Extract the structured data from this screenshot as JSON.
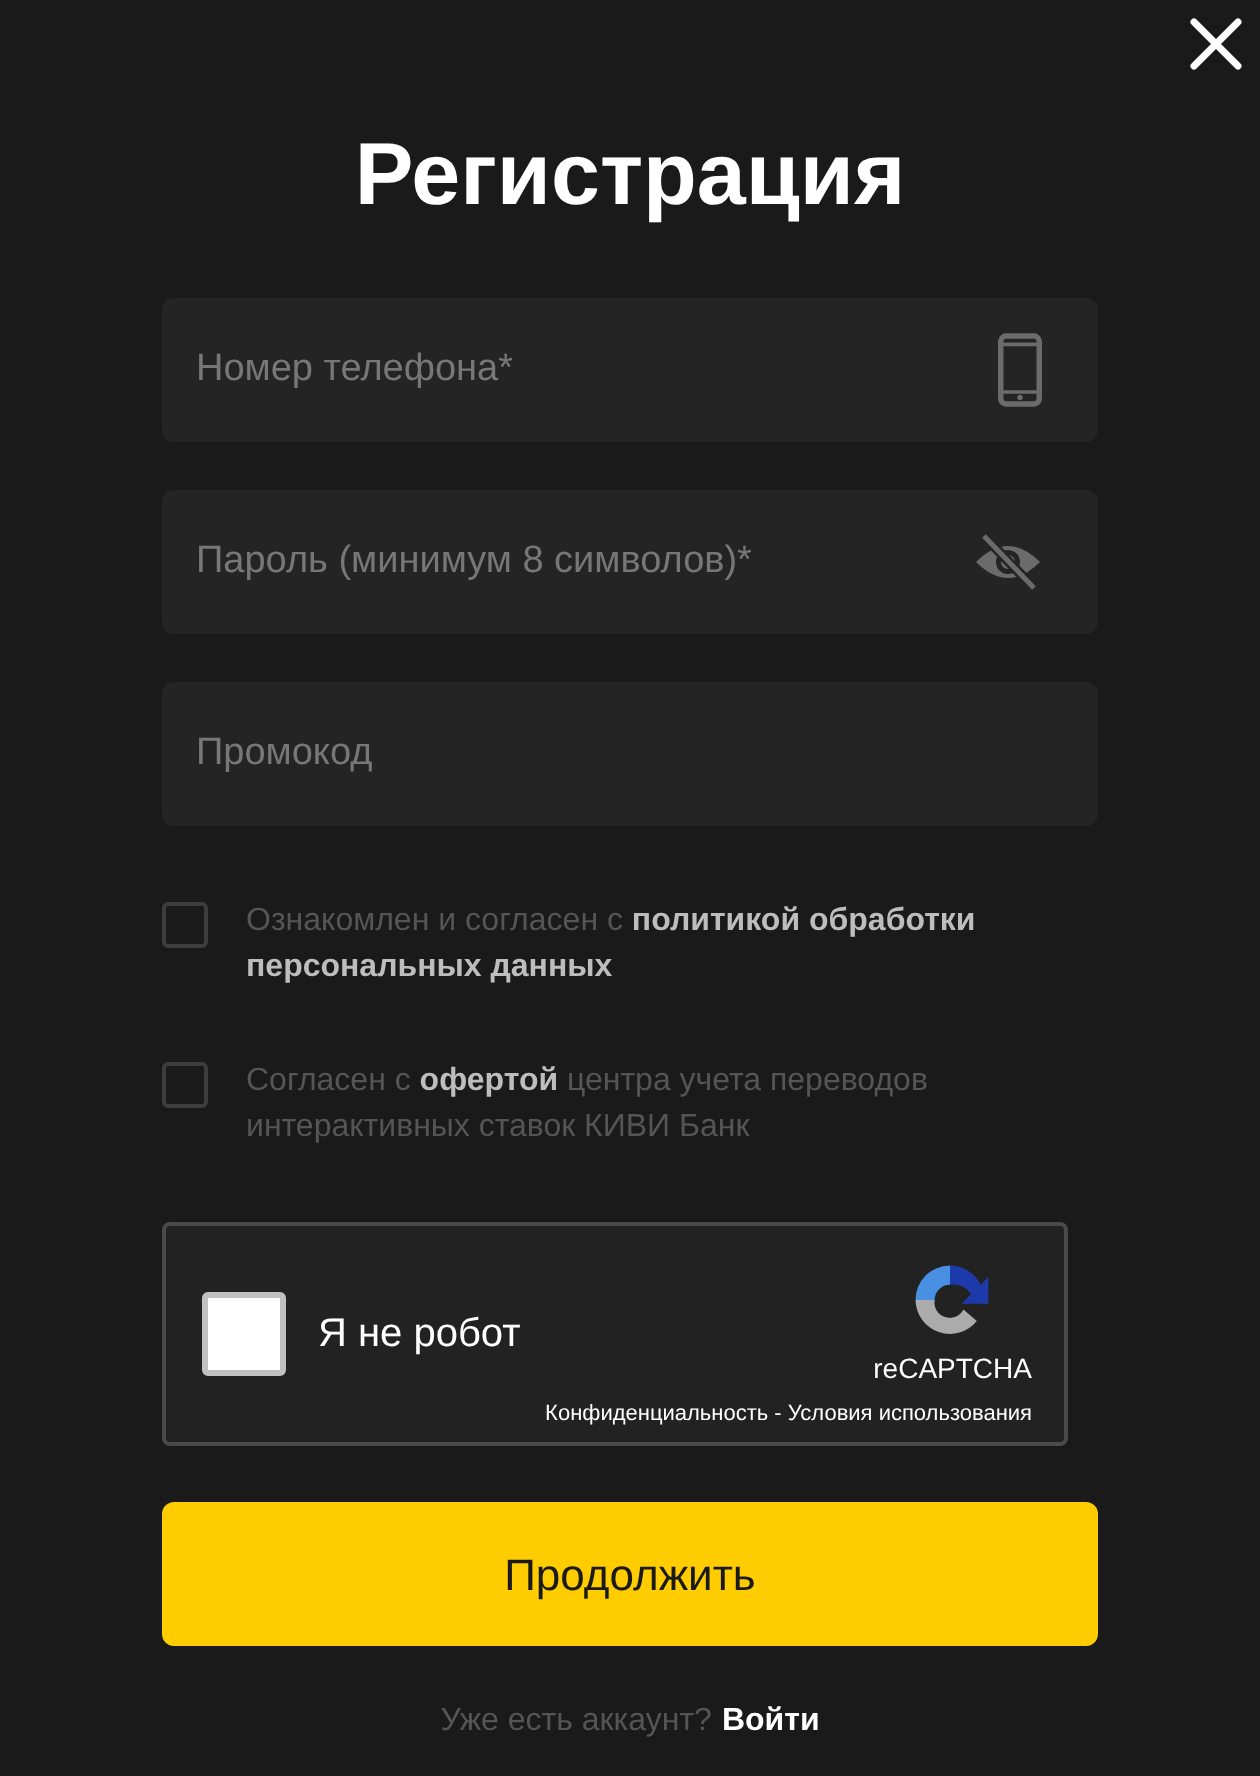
{
  "title": "Регистрация",
  "fields": [
    {
      "placeholder": "Номер телефона*",
      "kind": "phone"
    },
    {
      "placeholder": "Пароль (минимум 8 символов)*",
      "kind": "password"
    },
    {
      "placeholder": "Промокод",
      "kind": "text"
    }
  ],
  "agreements": [
    {
      "text": "Ознакомлен и согласен с **политикой обработки персональных данных**",
      "checked": false
    },
    {
      "text": "Согласен с **офертой** центра учета переводов интерактивных ставок КИВИ Банк",
      "checked": false
    }
  ],
  "captcha": {
    "label": "Я не робот",
    "checked": false,
    "brand": "reCAPTCHA",
    "links": "Конфиденциальность - Условия использования"
  },
  "submit": "Продолжить",
  "footer": {
    "text": "Уже есть аккаунт?",
    "link": "Войти"
  }
}
